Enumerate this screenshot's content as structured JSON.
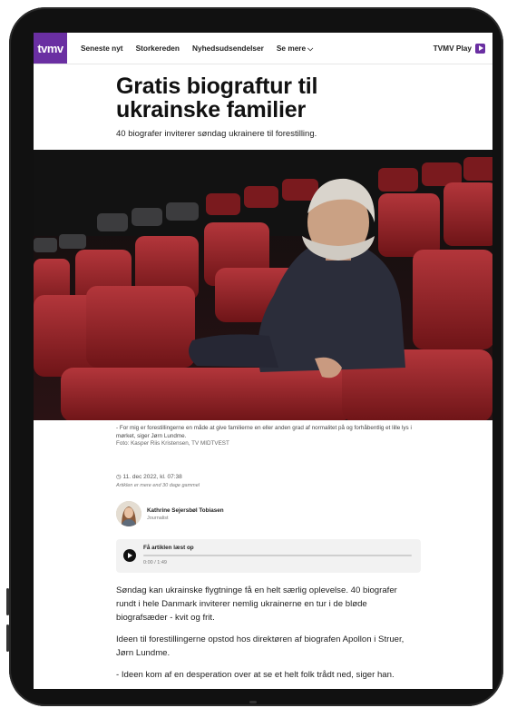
{
  "nav": {
    "logo": "tvmv",
    "links": [
      "Seneste nyt",
      "Storkereden",
      "Nyhedsudsendelser",
      "Se mere"
    ],
    "right": "TVMV Play"
  },
  "article": {
    "title": "Gratis biograftur til ukrainske familier",
    "subtitle": "40 biografer inviterer søndag ukrainere til forestilling.",
    "caption": "- For mig er forestillingerne en måde at give familierne en eller anden grad af normalitet på og forhåbentlig et lille lys i mørket, siger Jørn Lundme.",
    "credit": "Foto: Kasper Riis Kristensen, TV MIDTVEST",
    "date": "11. dec 2022, kl. 07:38",
    "age_note": "Artiklen er mere end 30 dage gammel",
    "author_name": "Kathrine Sejersbøl Tobiasen",
    "author_role": "Journalist",
    "audio_label": "Få artiklen læst op",
    "audio_time": "0:00 / 1:49",
    "paragraphs": [
      "Søndag kan ukrainske flygtninge få en helt særlig oplevelse. 40 biografer rundt i hele Danmark inviterer nemlig ukrainerne en tur i de bløde biografsæder - kvit og frit.",
      "Ideen til forestillingerne opstod hos direktøren af biografen Apollon i Struer, Jørn Lundme.",
      "- Ideen kom af en desperation over at se et helt folk trådt ned, siger han."
    ]
  },
  "colors": {
    "brand": "#6a2fa2",
    "seat": "#8e1f24"
  }
}
